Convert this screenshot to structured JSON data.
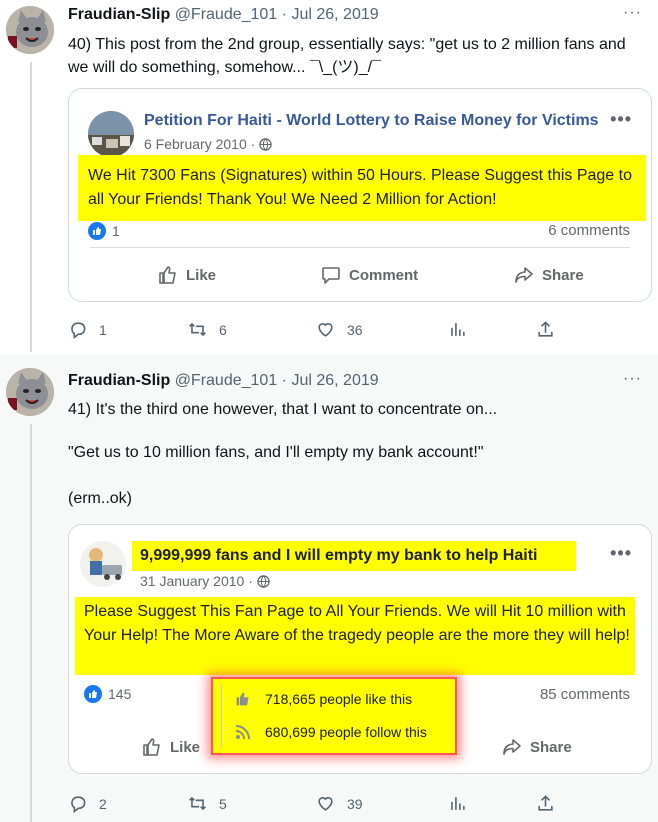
{
  "tweets": [
    {
      "author_name": "Fraudian-Slip",
      "handle": "@Fraude_101",
      "separator": "·",
      "date": "Jul 26, 2019",
      "more": "···",
      "text": "40) This post from the 2nd group, essentially says: \"get us to 2 million fans and we will do something, somehow... ¯\\_(ツ)_/¯",
      "embed": {
        "page_title": "Petition For Haiti - World Lottery to Raise Money for Victims",
        "date": "6 February 2010 ·",
        "more": "•••",
        "body": "We Hit 7300 Fans (Signatures) within 50 Hours. Please Suggest this Page to all Your Friends! Thank You! We Need 2 Million for Action!",
        "reactions": "1",
        "comments": "6 comments",
        "like_label": "Like",
        "comment_label": "Comment",
        "share_label": "Share"
      },
      "actions": {
        "replies": "1",
        "retweets": "6",
        "likes": "36"
      }
    },
    {
      "author_name": "Fraudian-Slip",
      "handle": "@Fraude_101",
      "separator": "·",
      "date": "Jul 26, 2019",
      "more": "···",
      "text_lines": [
        "41) It's the third one however, that I want to concentrate on...",
        "\"Get us to 10 million fans, and I'll empty my bank account!\"",
        "(erm..ok)"
      ],
      "embed": {
        "page_title": "9,999,999 fans and I will empty my bank to help Haiti",
        "date": "31 January 2010 ·",
        "more": "•••",
        "body": "Please Suggest This Fan Page to All Your Friends. We will Hit 10 million with Your Help! The More Aware of the tragedy people are the more they will help!",
        "reactions": "145",
        "comments": "85 comments",
        "like_label": "Like",
        "share_label": "Share",
        "likes_stat": "718,665 people like this",
        "follows_stat": "680,699 people follow this"
      },
      "actions": {
        "replies": "2",
        "retweets": "5",
        "likes": "39"
      }
    }
  ],
  "colors": {
    "accent_link": "#385898",
    "highlight": "#ffff00",
    "fb_blue": "#1877f2",
    "muted": "#536471",
    "callout_border": "#ff5555"
  },
  "icons": [
    "reply-icon",
    "retweet-icon",
    "heart-icon",
    "analytics-icon",
    "share-icon",
    "thumbs-up-icon",
    "comment-icon",
    "share-arrow-icon",
    "globe-icon",
    "rss-icon"
  ]
}
